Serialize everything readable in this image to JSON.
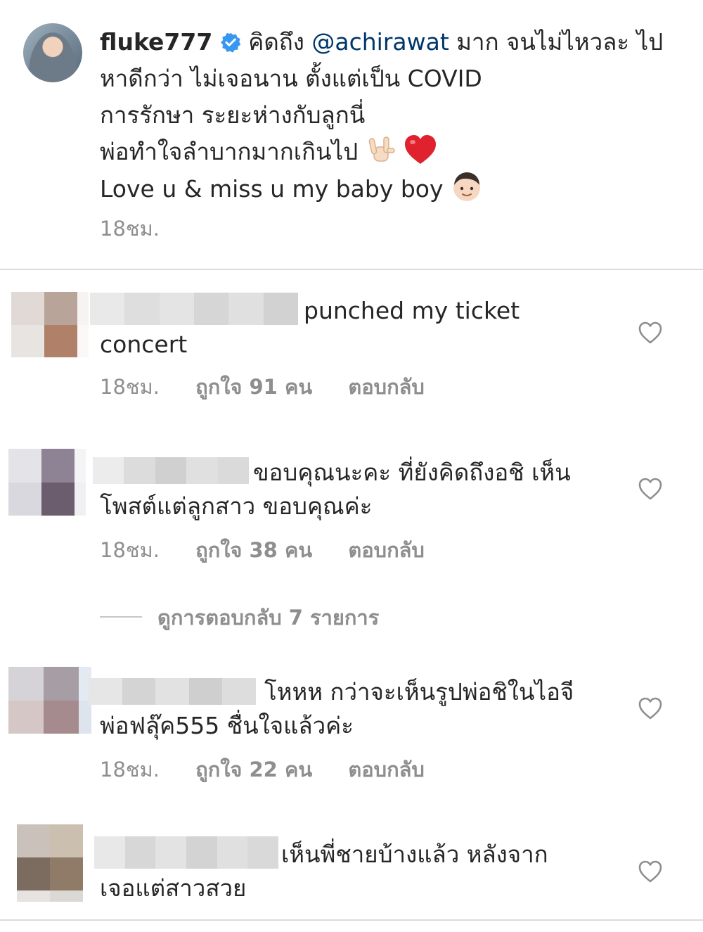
{
  "post": {
    "username": "fluke777",
    "mention": "@achirawat",
    "line1_a": "คิดถึง",
    "line1_b": "มาก จนไม่ไหวละ ไป",
    "line2": "หาดีกว่า ไม่เจอนาน ตั้งแต่เป็น COVID",
    "line3": "การรักษา ระยะห่างกับลูกนี่",
    "line4": "พ่อทำใจลำบากมากเกินไป",
    "line5": "Love u & miss u my baby boy",
    "time": "18ชม."
  },
  "comments": [
    {
      "text_first": "punched my ticket",
      "text_rest": "concert",
      "time": "18ชม.",
      "likes": "ถูกใจ 91 คน",
      "reply": "ตอบกลับ"
    },
    {
      "text_first": "ขอบคุณนะคะ ที่ยังคิดถึงอชิ เห็น",
      "text_rest": "โพสต์แต่ลูกสาว ขอบคุณค่ะ",
      "time": "18ชม.",
      "likes": "ถูกใจ 38 คน",
      "reply": "ตอบกลับ",
      "view_replies": "ดูการตอบกลับ 7 รายการ"
    },
    {
      "text_first": "โหหห กว่าจะเห็นรูปพ่อชิในไอจี",
      "text_rest": "พ่อฟลุ๊ค555 ชื่นใจแล้วค่ะ",
      "time": "18ชม.",
      "likes": "ถูกใจ 22 คน",
      "reply": "ตอบกลับ"
    },
    {
      "text_first": "เห็นพี่ชายบ้างแล้ว หลังจาก",
      "text_rest": "เจอแต่สาวสวย"
    }
  ],
  "icons": {
    "verified": "verified-badge-icon",
    "heart": "heart-outline-icon",
    "emoji_1": "love-you-gesture-emoji",
    "emoji_2": "red-heart-emoji",
    "emoji_3": "boy-face-emoji"
  },
  "colors": {
    "mention": "#00376b",
    "verified": "#3897f0",
    "meta": "#8e8e8e",
    "divider": "#dbdbdb"
  }
}
